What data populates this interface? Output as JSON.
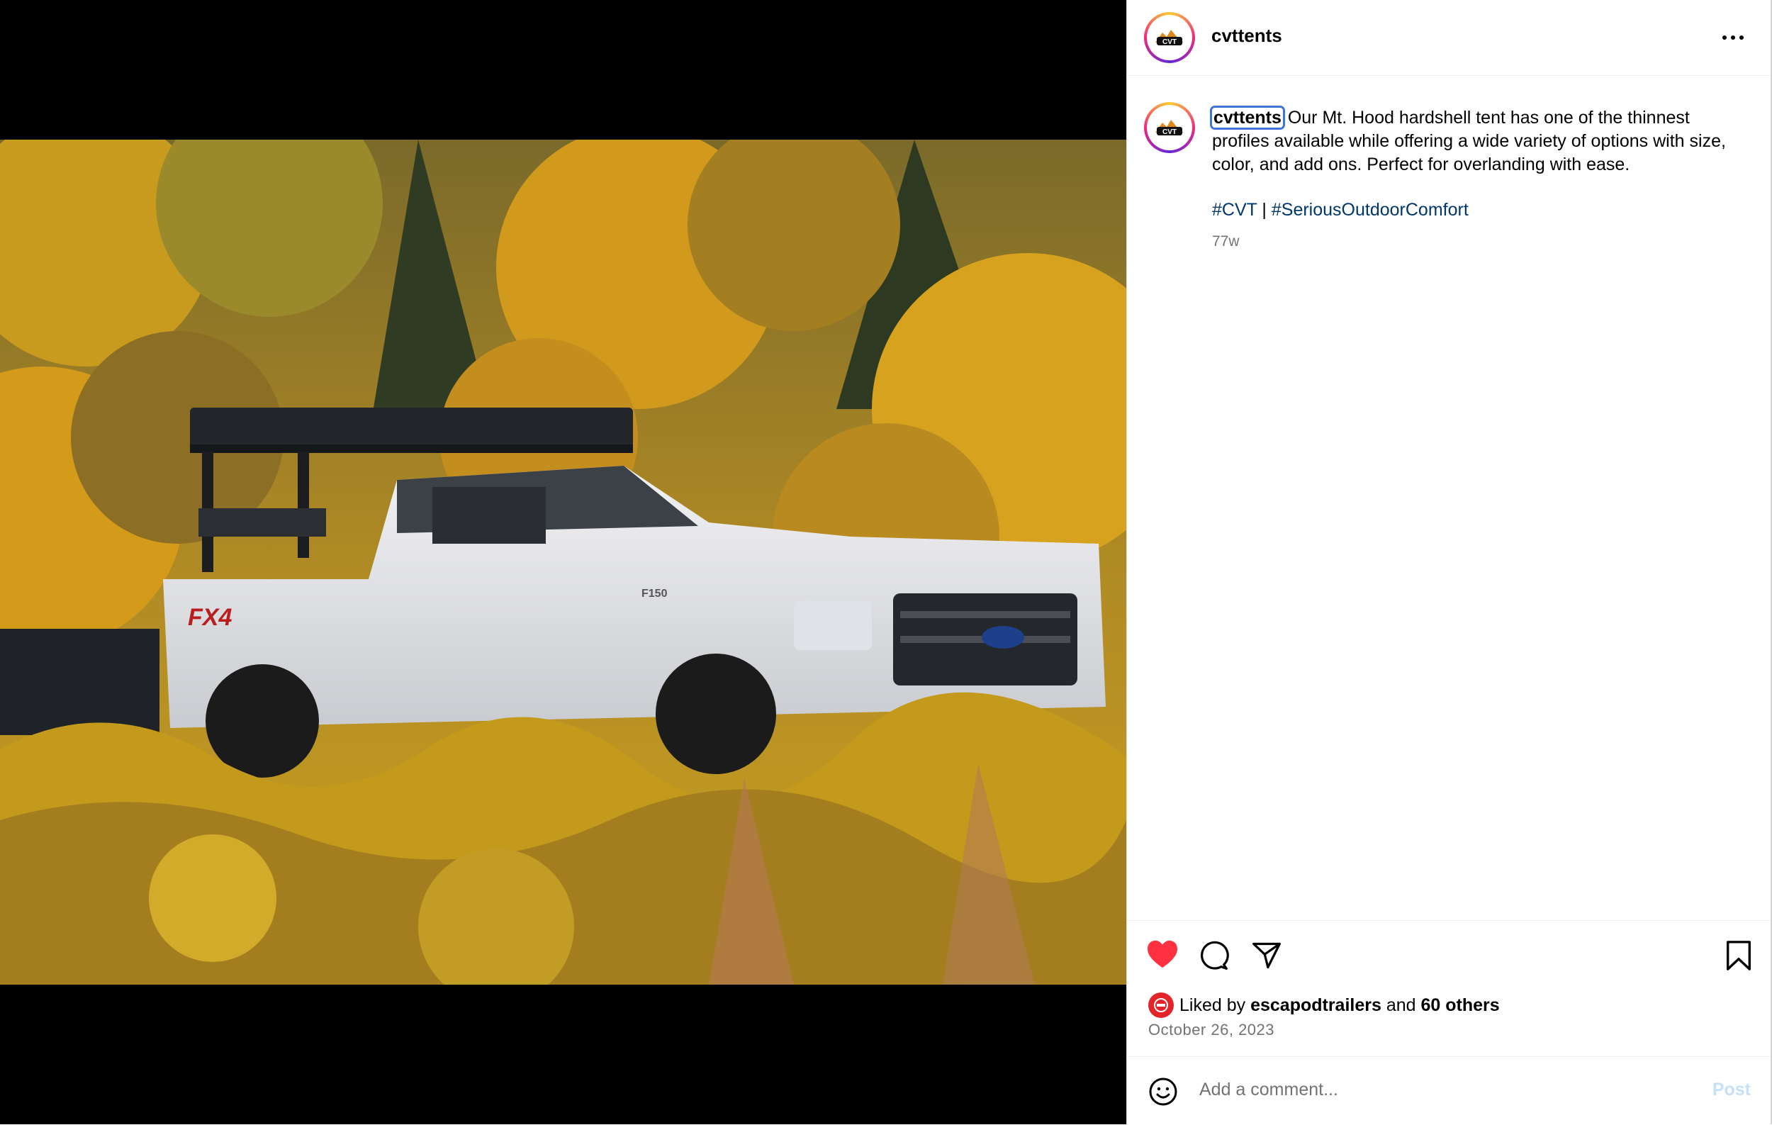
{
  "post": {
    "username": "cvttents",
    "avatar_text": "CVT",
    "caption_username": "cvttents",
    "caption_text": "Our Mt. Hood hardshell tent has one of the thinnest profiles available while offering a wide variety of options with size, color, and add ons. Perfect for overlanding with ease.",
    "hashtag_1": "#CVT",
    "separator": "|",
    "hashtag_2": "#SeriousOutdoorComfort",
    "age": "77w"
  },
  "photo": {
    "badge_text": "FX4",
    "model_text": "F150"
  },
  "actions": {
    "liked_prefix": "Liked by",
    "liked_user": "escapodtrailers",
    "liked_and": "and",
    "liked_others": "60 others",
    "date": "October 26, 2023",
    "liked": true
  },
  "comment": {
    "placeholder": "Add a comment...",
    "post_label": "Post"
  },
  "colors": {
    "like_red": "#ff3040",
    "hashtag_blue": "#00376b",
    "post_disabled": "#c5e1fa",
    "focus_outline": "#3f74d9"
  }
}
